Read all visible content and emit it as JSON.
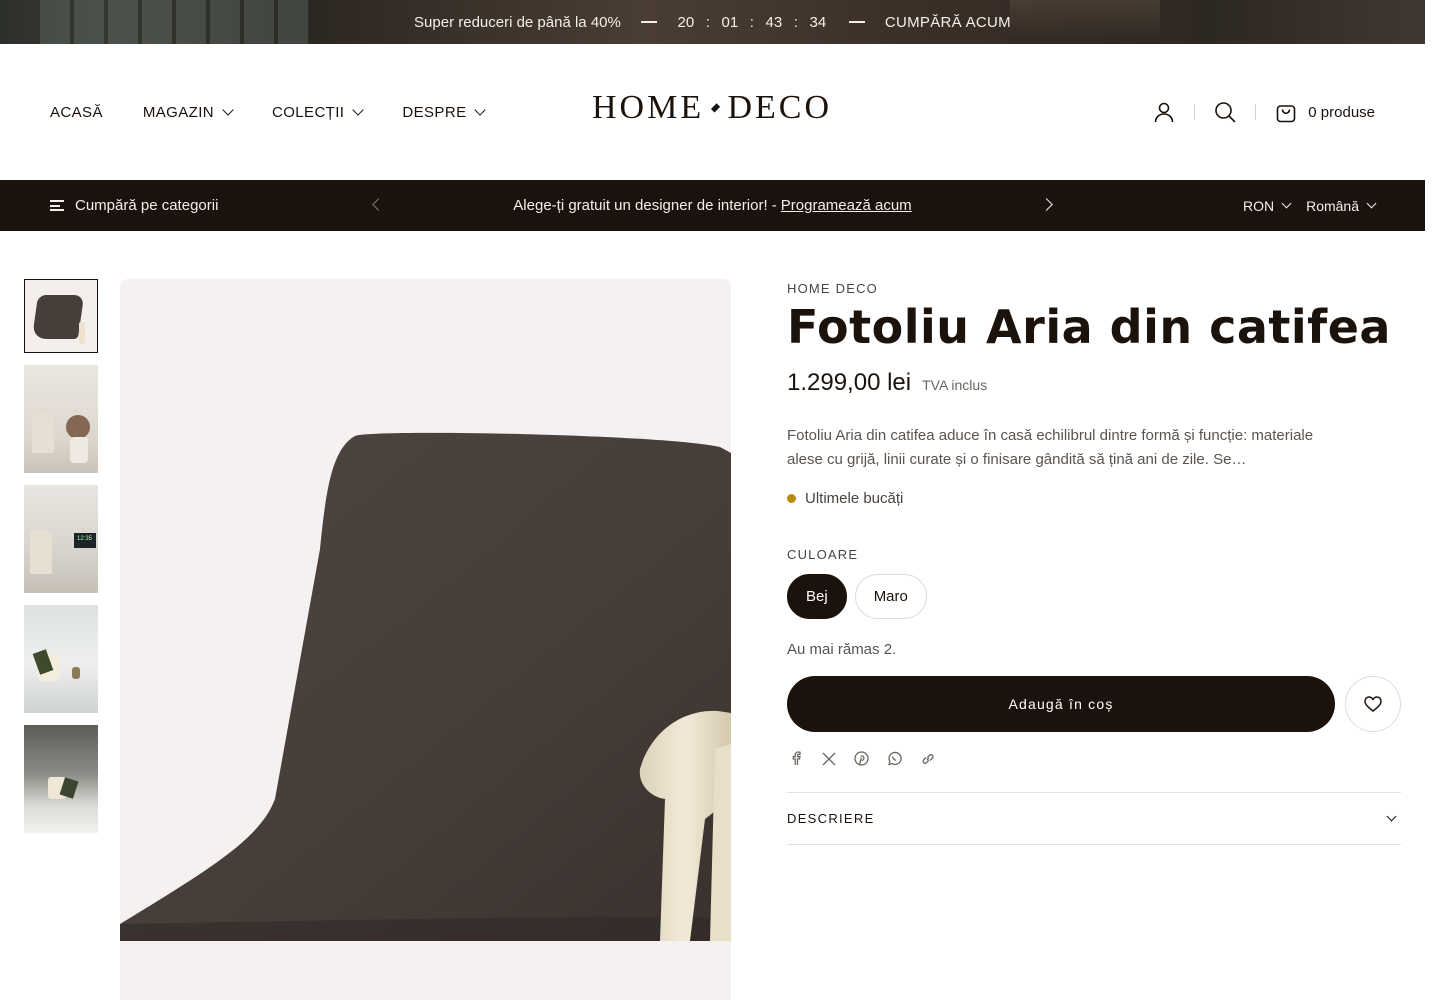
{
  "topbar": {
    "promo": "Super reduceri de până la 40%",
    "countdown": [
      "20",
      "01",
      "43",
      "34"
    ],
    "separator": ":",
    "cta": "CUMPĂRĂ ACUM"
  },
  "header": {
    "nav": [
      {
        "label": "ACASĂ",
        "dropdown": false
      },
      {
        "label": "MAGAZIN",
        "dropdown": true
      },
      {
        "label": "COLECȚII",
        "dropdown": true
      },
      {
        "label": "DESPRE",
        "dropdown": true
      }
    ],
    "logo_left": "HOME",
    "logo_right": "DECO",
    "icons": [
      "account-icon",
      "search-icon",
      "cart-icon"
    ],
    "cart_label": "0 produse"
  },
  "subbar": {
    "categories_label": "Cumpără pe categorii",
    "announcement": "Alege-ți gratuit un designer de interior! -",
    "announcement_link": "Programează acum",
    "currency": "RON",
    "language": "Română"
  },
  "product": {
    "vendor": "HOME DECO",
    "title": "Fotoliu Aria din catifea",
    "price": "1.299,00 lei",
    "tax_note": "TVA inclus",
    "description": "Fotoliu Aria din catifea aduce în casă echilibrul dintre formă și funcție: materiale alese cu grijă, linii curate și o finisare gândită să țină ani de zile. Se…",
    "stock_status": "Ultimele bucăți",
    "stock_color": "#b88a10",
    "option_label": "CULOARE",
    "options": [
      {
        "label": "Bej",
        "selected": true
      },
      {
        "label": "Maro",
        "selected": false
      }
    ],
    "remaining": "Au mai rămas 2.",
    "add_to_cart": "Adaugă în coș",
    "share_icons": [
      "facebook-icon",
      "x-icon",
      "pinterest-icon",
      "whatsapp-icon",
      "link-icon"
    ],
    "accordion_label": "DESCRIERE",
    "thumbnail_screen_text": "12:35"
  },
  "colors": {
    "dark": "#1c120c",
    "accent_gold": "#b88a10",
    "image_bg": "#f5f1f0"
  }
}
